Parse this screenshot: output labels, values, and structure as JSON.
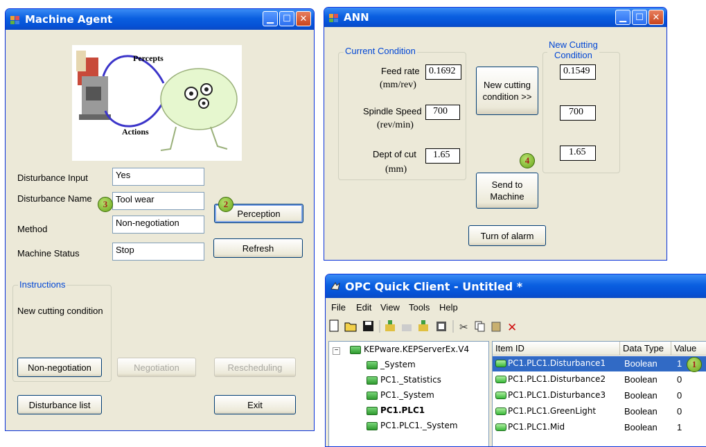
{
  "machine_agent": {
    "title": "Machine Agent",
    "diagram": {
      "percepts": "Percepts",
      "actions": "Actions"
    },
    "fields": [
      {
        "label": "Disturbance Input",
        "value": "Yes"
      },
      {
        "label": "Disturbance Name",
        "value": "Tool wear"
      },
      {
        "label": "Method",
        "value": "Non-negotiation"
      },
      {
        "label": "Machine Status",
        "value": "Stop"
      }
    ],
    "perception_button": "Perception",
    "refresh_button": "Refresh",
    "instructions_title": "Instructions",
    "instructions_text": "New cutting condition",
    "non_negotiation_button": "Non-negotiation",
    "negotiation_button": "Negotiation",
    "rescheduling_button": "Rescheduling",
    "disturbance_list_button": "Disturbance list",
    "exit_button": "Exit",
    "marker_2": "2",
    "marker_3": "3"
  },
  "ann": {
    "title": "ANN",
    "current_title": "Current Condition",
    "new_title_1": "New Cutting",
    "new_title_2": "Condition",
    "feed_rate_label": "Feed rate",
    "feed_rate_unit": "(mm/rev)",
    "feed_rate_value": "0.1692",
    "spindle_label": "Spindle Speed",
    "spindle_unit": "(rev/min)",
    "spindle_value": "700",
    "depth_label": "Dept of cut",
    "depth_unit": "(mm)",
    "depth_value": "1.65",
    "new_feed": "0.1549",
    "new_spindle": "700",
    "new_depth": "1.65",
    "new_cutting_button_1": "New cutting",
    "new_cutting_button_2": "condition >>",
    "send_button_1": "Send to",
    "send_button_2": "Machine",
    "alarm_button": "Turn of alarm",
    "marker_4": "4"
  },
  "opc": {
    "title": "OPC Quick Client - Untitled *",
    "menu": [
      "File",
      "Edit",
      "View",
      "Tools",
      "Help"
    ],
    "tree": {
      "root": "KEPware.KEPServerEx.V4",
      "items": [
        "_System",
        "PC1._Statistics",
        "PC1._System",
        "PC1.PLC1",
        "PC1.PLC1._System"
      ]
    },
    "columns": [
      "Item ID",
      "Data Type",
      "Value"
    ],
    "rows": [
      {
        "id": "PC1.PLC1.Disturbance1",
        "type": "Boolean",
        "value": "1"
      },
      {
        "id": "PC1.PLC1.Disturbance2",
        "type": "Boolean",
        "value": "0"
      },
      {
        "id": "PC1.PLC1.Disturbance3",
        "type": "Boolean",
        "value": "0"
      },
      {
        "id": "PC1.PLC1.GreenLight",
        "type": "Boolean",
        "value": "0"
      },
      {
        "id": "PC1.PLC1.Mid",
        "type": "Boolean",
        "value": "1"
      }
    ],
    "marker_1": "1"
  }
}
